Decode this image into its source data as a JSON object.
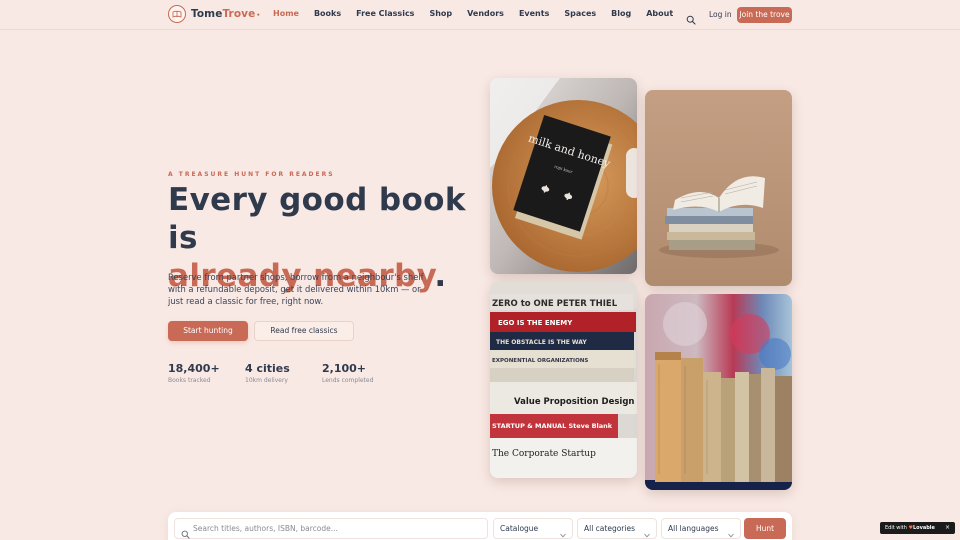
{
  "app": {
    "brand_part1": "Tome",
    "brand_part2": "Trove",
    "brand_suffix": "•"
  },
  "nav": {
    "items": [
      {
        "label": "Home",
        "active": true
      },
      {
        "label": "Books"
      },
      {
        "label": "Free Classics"
      },
      {
        "label": "Shop"
      },
      {
        "label": "Vendors"
      },
      {
        "label": "Events"
      },
      {
        "label": "Spaces"
      },
      {
        "label": "Blog"
      },
      {
        "label": "About"
      }
    ],
    "search_icon": "search-icon",
    "login_label": "Log in",
    "join_label": "Join the trove"
  },
  "hero": {
    "eyebrow": "A TREASURE HUNT FOR READERS",
    "headline_part1": "Every good book is",
    "headline_accent": "already nearby",
    "headline_end": ".",
    "lead": "Reserve from partner shops, borrow from a neighbour's shelf with a refundable deposit, get it delivered within 10km — or just read a classic for free, right now.",
    "primary_cta": "Start hunting",
    "secondary_cta": "Read free classics",
    "stats": [
      {
        "value": "18,400+",
        "label": "Books tracked"
      },
      {
        "value": "4 cities",
        "label": "10km delivery"
      },
      {
        "value": "2,100+",
        "label": "Lends completed"
      }
    ]
  },
  "images": {
    "tile1_book_title": "milk and honey",
    "tile1_book_author": "rupi kaur",
    "tile3_spines": [
      {
        "text": "ZERO to ONE   PETER THIEL"
      },
      {
        "text": "EGO IS THE ENEMY"
      },
      {
        "text": "THE OBSTACLE IS THE WAY"
      },
      {
        "text": "EXPONENTIAL ORGANIZATIONS"
      },
      {
        "text": "Value Proposition Design"
      },
      {
        "text": "STARTUP & MANUAL   Steve Blank"
      },
      {
        "text": "The Corporate Startup"
      }
    ]
  },
  "search": {
    "placeholder": "Search titles, authors, ISBN, barcode...",
    "value": "",
    "catalogue": "Catalogue",
    "categories": "All categories",
    "languages": "All languages",
    "submit": "Hunt"
  },
  "badge": {
    "prefix": "Edit with",
    "brand": "Lovable",
    "close": "×"
  },
  "colors": {
    "background": "#f9e9e4",
    "accent": "#c86a55",
    "ink": "#2f3a4d"
  }
}
